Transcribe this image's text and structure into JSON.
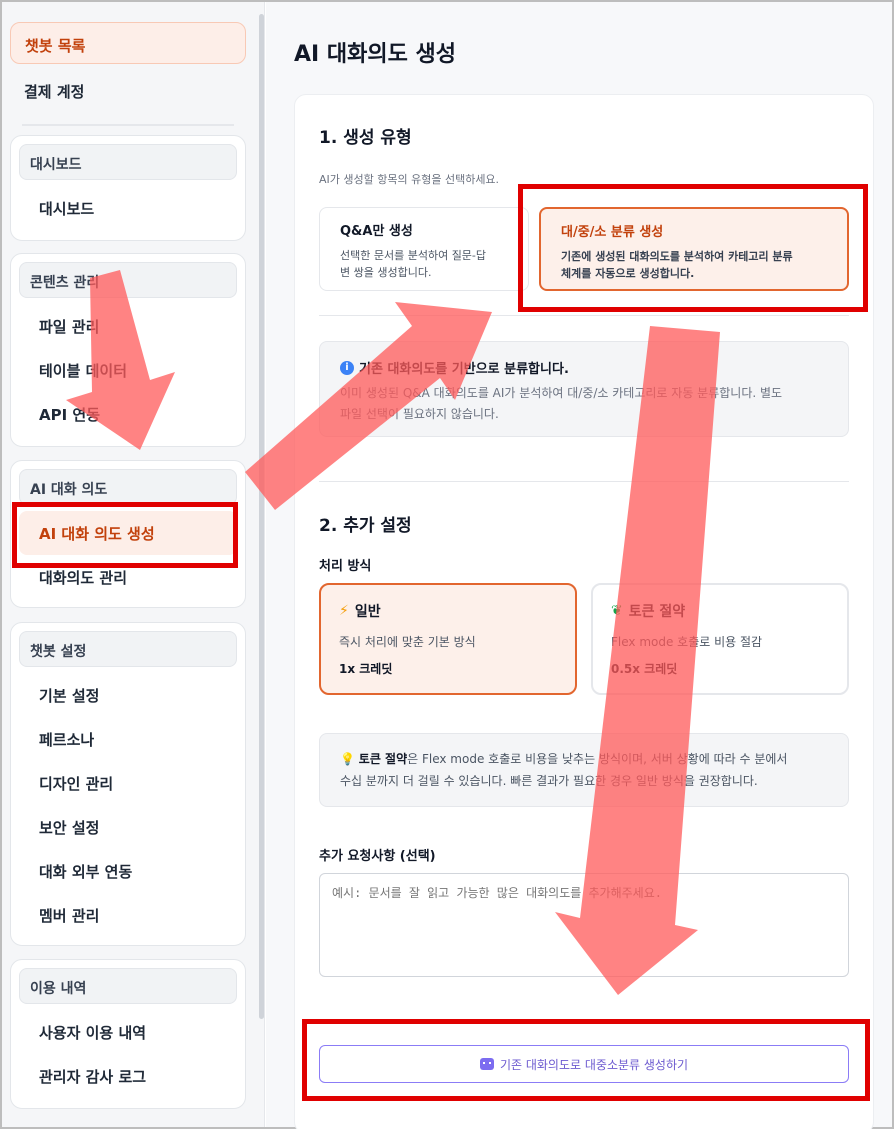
{
  "sidebar": {
    "top_items": [
      {
        "label": "챗봇 목록",
        "active": true
      },
      {
        "label": "결제 계정",
        "active": false
      }
    ],
    "groups": [
      {
        "title": "대시보드",
        "items": [
          "대시보드"
        ]
      },
      {
        "title": "콘텐츠 관리",
        "items": [
          "파일 관리",
          "테이블 데이터",
          "API 연동"
        ]
      },
      {
        "title": "AI 대화 의도",
        "items": [
          "AI 대화 의도 생성",
          "대화의도 관리"
        ]
      },
      {
        "title": "챗봇 설정",
        "items": [
          "기본 설정",
          "페르소나",
          "디자인 관리",
          "보안 설정",
          "대화 외부 연동",
          "멤버 관리"
        ]
      },
      {
        "title": "이용 내역",
        "items": [
          "사용자 이용 내역",
          "관리자 감사 로그"
        ]
      }
    ]
  },
  "main": {
    "title": "AI 대화의도 생성",
    "section1": {
      "title": "1. 생성 유형",
      "hint": "AI가 생성할 항목의 유형을 선택하세요.",
      "options": [
        {
          "title": "Q&A만 생성",
          "desc_line1": "선택한 문서를 분석하여 질문-답",
          "desc_line2": "변 쌍을 생성합니다."
        },
        {
          "title": "대/중/소 분류 생성",
          "desc_line1": "기존에 생성된 대화의도를 분석하여 카테고리 분류",
          "desc_line2": "체계를 자동으로 생성합니다."
        }
      ],
      "info": {
        "heading": "기존 대화의도를 기반으로 분류합니다.",
        "body_line1": "이미 생성된 Q&A 대화의도를 AI가 분석하여 대/중/소 카테고리로 자동 분류합니다. 별도",
        "body_line2": "파일 선택이 필요하지 않습니다."
      }
    },
    "section2": {
      "title": "2. 추가 설정",
      "mode_label": "처리 방식",
      "modes": [
        {
          "title": "일반",
          "desc": "즉시 처리에 맞춘 기본 방식",
          "credit": "1x 크레딧"
        },
        {
          "title": "토큰 절약",
          "desc": "Flex mode 호출로 비용 절감",
          "credit": "0.5x 크레딧"
        }
      ],
      "tip": {
        "strong": "토큰 절약",
        "text_line1": "은 Flex mode 호출로 비용을 낮추는 방식이며, 서버 상황에 따라 수 분에서",
        "text_line2": "수십 분까지 더 걸릴 수 있습니다. 빠른 결과가 필요한 경우 일반 방식을 권장합니다."
      },
      "request_label": "추가 요청사항 (선택)",
      "request_placeholder": "예시: 문서를 잘 읽고 가능한 많은 대화의도를 추가해주세요.",
      "request_value": ""
    },
    "generate_button": "기존 대화의도로 대중소분류 생성하기"
  },
  "colors": {
    "accent": "#e2662f",
    "accent_bg": "#fdf0ea",
    "button_border": "#8b7cf6",
    "annotation_red": "#e00000",
    "annotation_arrow": "#ff6b6b"
  }
}
